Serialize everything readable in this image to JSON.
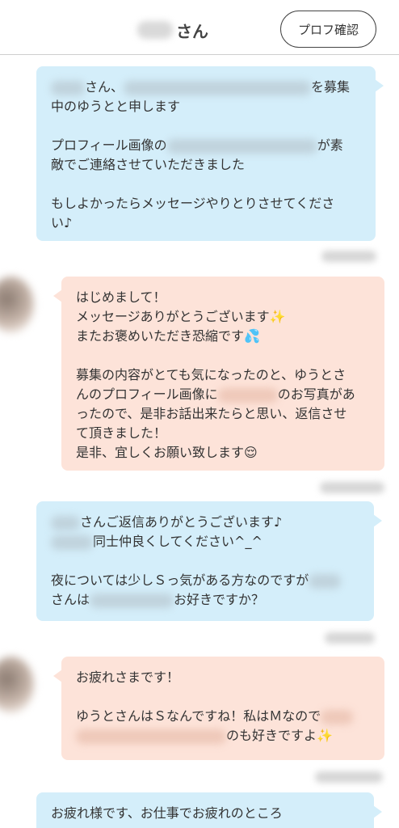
{
  "header": {
    "title": "さん",
    "profile_button": "プロフ確認"
  },
  "messages": [
    {
      "type": "sent",
      "lines": [
        "さん、",
        "を募集",
        "中のゆうとと申します",
        "プロフィール画像の",
        "が素",
        "敵でご連絡させていただきました",
        "もしよかったらメッセージやりとりさせてくださ",
        "い♪"
      ]
    },
    {
      "type": "received",
      "lines": [
        "はじめまして！",
        "メッセージありがとうございます",
        "またお褒めいただき恐縮です",
        "募集の内容がとても気になったのと、ゆうとさ",
        "んのプロフィール画像に",
        "のお写真があ",
        "ったので、是非お話出来たらと思い、返信させ",
        "て頂きました！",
        "是非、宜しくお願い致します"
      ]
    },
    {
      "type": "sent",
      "lines": [
        "さんご返信ありがとうございます♪",
        "同士仲良くしてください^_^",
        "夜については少しＳっ気がある方なのですが",
        "さんは",
        "お好きですか？"
      ]
    },
    {
      "type": "received",
      "lines": [
        "お疲れさまです！",
        "ゆうとさんはＳなんですね！私はＭなので",
        "のも好きですよ"
      ]
    },
    {
      "type": "sent",
      "lines": [
        "お疲れ様です、お仕事でお疲れのところ"
      ]
    }
  ],
  "icons": [
    "sparkle-icon",
    "sweat-drops-icon",
    "relieved-face-icon"
  ],
  "colors": {
    "sent_bubble": "#d4eefa",
    "received_bubble": "#fde3d9",
    "header_border": "#cfcfcf"
  }
}
